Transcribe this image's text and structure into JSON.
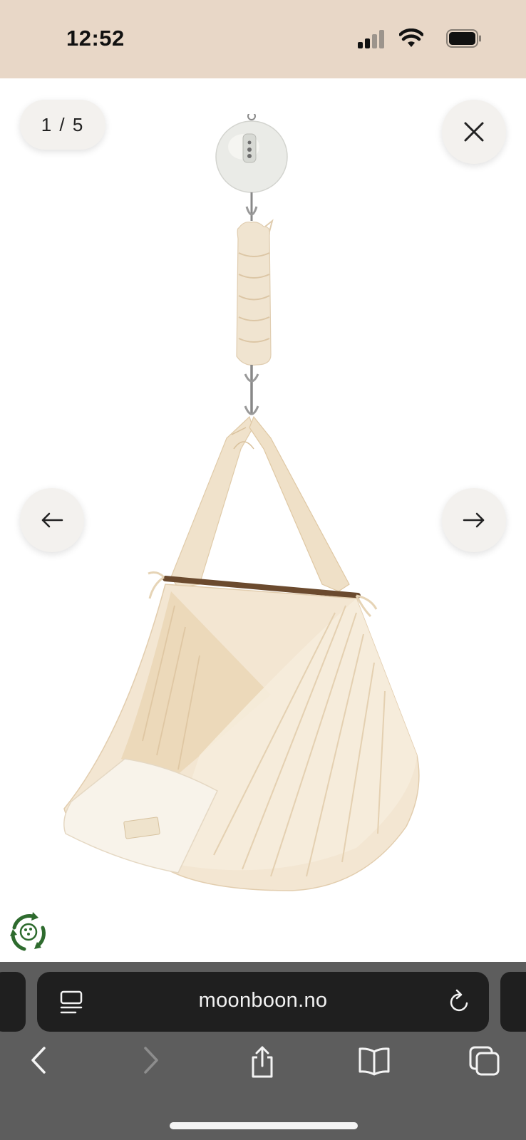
{
  "status_bar": {
    "time": "12:52",
    "background": "#e8d7c7",
    "icons": [
      "signal-icon",
      "wifi-icon",
      "battery-icon"
    ]
  },
  "gallery": {
    "counter": "1 / 5",
    "icons": [
      "close-icon",
      "arrow-left-icon",
      "arrow-right-icon"
    ],
    "image": "hanging baby hammock with spring and motor"
  },
  "browser": {
    "url": "moonboon.no",
    "icons": [
      "reader-icon",
      "reload-icon",
      "back-icon",
      "forward-icon",
      "share-icon",
      "bookmarks-icon",
      "tabs-icon"
    ]
  },
  "colors": {
    "fabric": "#f1e5d2",
    "fabric_shadow": "#e2cfb2",
    "toolbar": "#5d5d5d",
    "url_bar": "#1f1f1f",
    "eco_green": "#2e6b2e"
  }
}
